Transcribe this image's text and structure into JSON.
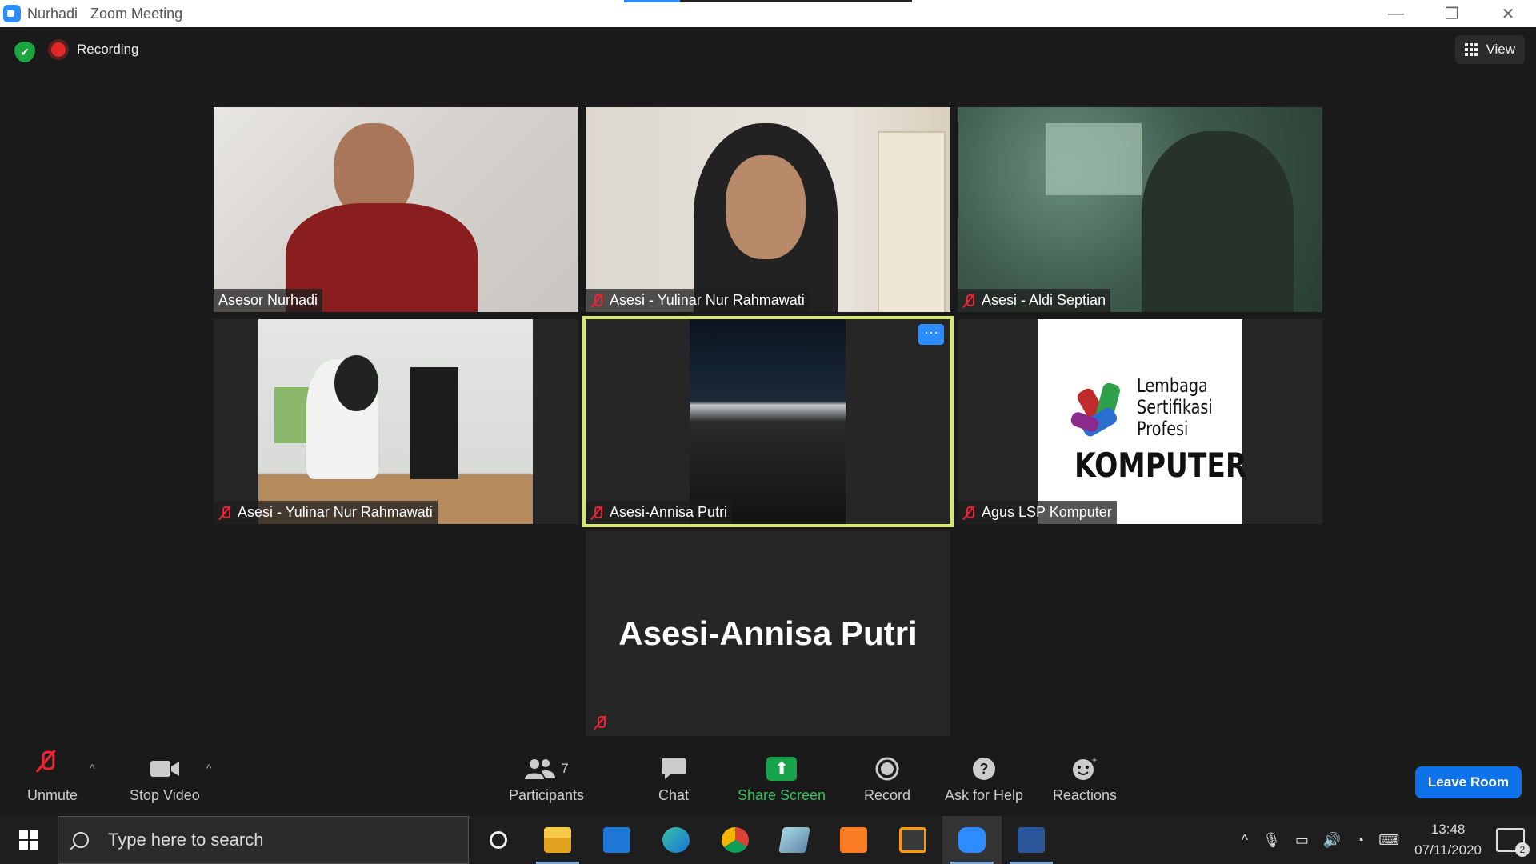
{
  "window": {
    "app_user": "Nurhadi",
    "title": "Zoom Meeting"
  },
  "top": {
    "recording_label": "Recording",
    "view_label": "View"
  },
  "tiles": [
    {
      "name": "Asesor Nurhadi",
      "muted": false
    },
    {
      "name": "Asesi - Yulinar Nur Rahmawati",
      "muted": true
    },
    {
      "name": "Asesi - Aldi Septian",
      "muted": true
    },
    {
      "name": "Asesi - Yulinar Nur Rahmawati",
      "muted": true
    },
    {
      "name": "Asesi-Annisa Putri",
      "muted": true
    },
    {
      "name": "Agus LSP Komputer",
      "muted": true
    }
  ],
  "more_label": "···",
  "speaker_tile": {
    "name": "Asesi-Annisa Putri"
  },
  "logo_text": {
    "l1": "Lembaga",
    "l2": "Sertifikasi",
    "l3": "Profesi",
    "l4": "KOMPUTER"
  },
  "toolbar": {
    "unmute": "Unmute",
    "stop_video": "Stop Video",
    "participants": "Participants",
    "participants_count": "7",
    "chat": "Chat",
    "share_screen": "Share Screen",
    "record": "Record",
    "ask_help": "Ask for Help",
    "reactions": "Reactions",
    "leave": "Leave Room"
  },
  "taskbar": {
    "search_placeholder": "Type here to search",
    "time": "13:48",
    "date": "07/11/2020",
    "notifications": "2"
  }
}
